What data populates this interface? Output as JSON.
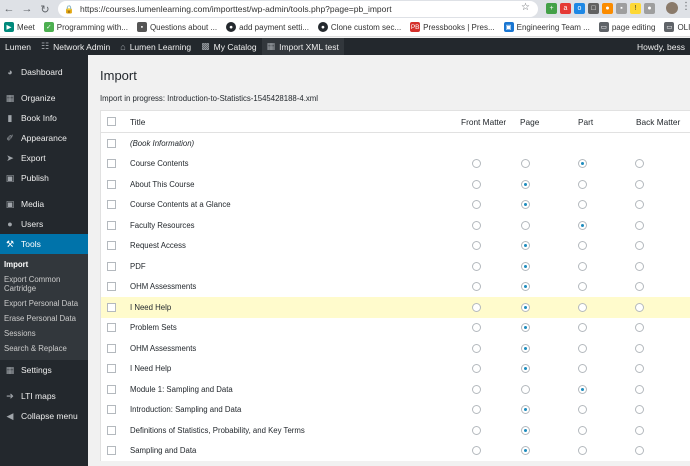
{
  "browser": {
    "url": "https://courses.lumenlearning.com/importtest/wp-admin/tools.php?page=pb_import",
    "bookmarks": [
      {
        "label": "Meet",
        "icon": "meet-icon",
        "color": "#00897b"
      },
      {
        "label": "Programming with...",
        "icon": "code-icon",
        "color": "#4caf50"
      },
      {
        "label": "Questions about ...",
        "icon": "doc-icon",
        "color": "#555555"
      },
      {
        "label": "add payment setti...",
        "icon": "github-icon",
        "color": "#24292e"
      },
      {
        "label": "Clone custom sec...",
        "icon": "github-icon",
        "color": "#24292e"
      },
      {
        "label": "Pressbooks | Pres...",
        "icon": "pressbooks-icon",
        "color": "#d4302b"
      },
      {
        "label": "Engineering Team ...",
        "icon": "team-icon",
        "color": "#1976d2"
      },
      {
        "label": "page editing",
        "icon": "folder-icon",
        "color": "#5f6368"
      },
      {
        "label": "OLI",
        "icon": "folder-icon",
        "color": "#5f6368"
      }
    ]
  },
  "adminbar": {
    "site": "Lumen",
    "network_admin": "Network Admin",
    "lumen_learning": "Lumen Learning",
    "my_catalog": "My Catalog",
    "current_book": "Import XML test",
    "howdy": "Howdy, bess"
  },
  "sidebar": {
    "dashboard": "Dashboard",
    "organize": "Organize",
    "book_info": "Book Info",
    "appearance": "Appearance",
    "export": "Export",
    "publish": "Publish",
    "media": "Media",
    "users": "Users",
    "tools": "Tools",
    "submenu": [
      "Import",
      "Export Common Cartridge",
      "Export Personal Data",
      "Erase Personal Data",
      "Sessions",
      "Search & Replace"
    ],
    "settings": "Settings",
    "lti_maps": "LTI maps",
    "collapse": "Collapse menu"
  },
  "main": {
    "title": "Import",
    "progress": "Import in progress: Introduction-to-Statistics-1545428188-4.xml",
    "headers": {
      "title": "Title",
      "front_matter": "Front Matter",
      "page": "Page",
      "part": "Part",
      "back_matter": "Back Matter"
    },
    "rows": [
      {
        "title": "(Book Information)",
        "type": "none",
        "italic": true
      },
      {
        "title": "Course Contents",
        "type": "part"
      },
      {
        "title": "About This Course",
        "type": "page"
      },
      {
        "title": "Course Contents at a Glance",
        "type": "page"
      },
      {
        "title": "Faculty Resources",
        "type": "part"
      },
      {
        "title": "Request Access",
        "type": "page"
      },
      {
        "title": "PDF",
        "type": "page"
      },
      {
        "title": "OHM Assessments",
        "type": "page"
      },
      {
        "title": "I Need Help",
        "type": "page",
        "highlight": true
      },
      {
        "title": "Problem Sets",
        "type": "page"
      },
      {
        "title": "OHM Assessments",
        "type": "page"
      },
      {
        "title": "I Need Help",
        "type": "page"
      },
      {
        "title": "Module 1: Sampling and Data",
        "type": "part"
      },
      {
        "title": "Introduction: Sampling and Data",
        "type": "page"
      },
      {
        "title": "Definitions of Statistics, Probability, and Key Terms",
        "type": "page"
      },
      {
        "title": "Sampling and Data",
        "type": "page"
      }
    ]
  }
}
